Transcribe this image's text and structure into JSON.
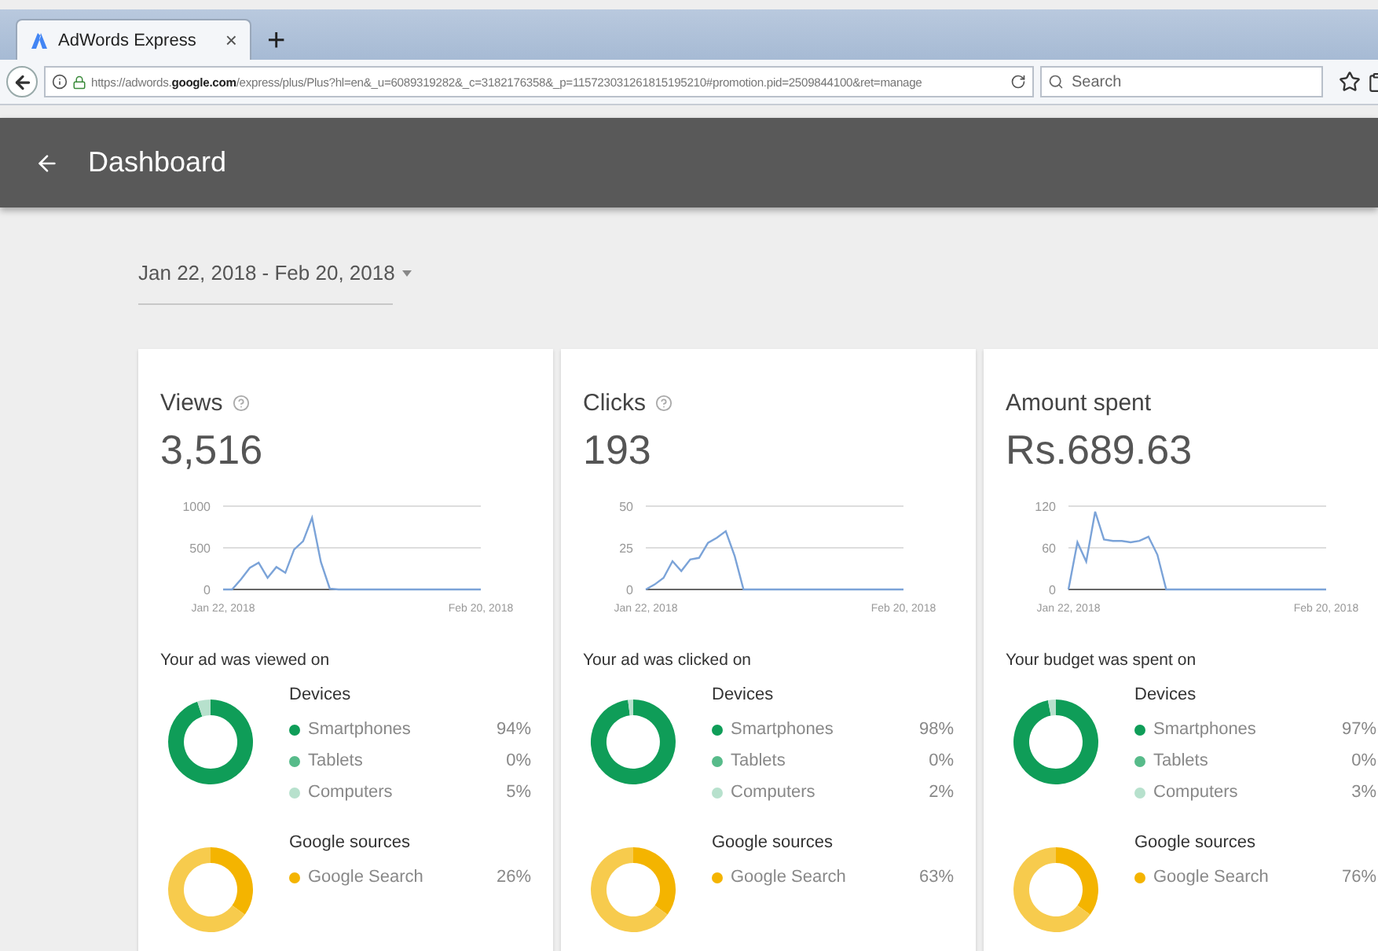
{
  "browser": {
    "tab_title": "AdWords Express",
    "tab_close": "×",
    "new_tab": "+",
    "url": "https://adwords.**google.com**/express/plus/Plus?hl=en&_u=6089319282&_c=3182176358&_p=115723031261815195210#promotion.pid=2509844100&ret=manage",
    "search_placeholder": "Search"
  },
  "header": {
    "title": "Dashboard"
  },
  "date_range": "Jan 22, 2018 - Feb 20, 2018",
  "cards": [
    {
      "title": "Views",
      "help": true,
      "value": "3,516",
      "chart_data": {
        "type": "line",
        "categories": [
          "Jan 22, 2018",
          null,
          null,
          null,
          null,
          null,
          null,
          null,
          null,
          null,
          null,
          null,
          null,
          null,
          null,
          null,
          null,
          null,
          null,
          null,
          null,
          null,
          null,
          null,
          null,
          null,
          null,
          null,
          null,
          "Feb 20, 2018"
        ],
        "values": [
          0,
          0,
          120,
          260,
          320,
          140,
          270,
          200,
          480,
          580,
          860,
          330,
          10,
          0,
          0,
          0,
          0,
          0,
          0,
          0,
          0,
          0,
          0,
          0,
          0,
          0,
          0,
          0,
          0,
          0
        ],
        "ylim": [
          0,
          1000
        ],
        "yticks": [
          0,
          500,
          1000
        ]
      },
      "breakdown_title": "Your ad was viewed on",
      "groups": [
        {
          "title": "Devices",
          "chart_data": {
            "type": "donut",
            "categories": [
              "Smartphones",
              "Tablets",
              "Computers"
            ],
            "values": [
              94,
              0,
              5
            ]
          },
          "items": [
            {
              "value": "94%",
              "color": "#0f9d58"
            },
            {
              "value": "0%",
              "color": "#57bb8a"
            },
            {
              "value": "5%",
              "color": "#b7e1cd"
            }
          ]
        },
        {
          "title": "Google sources",
          "items": [
            {
              "label": "Google Search",
              "value": "26%",
              "color": "#f4b400"
            }
          ]
        }
      ]
    },
    {
      "title": "Clicks",
      "help": true,
      "value": "193",
      "chart_data": {
        "type": "line",
        "categories": [
          "Jan 22, 2018",
          null,
          null,
          null,
          null,
          null,
          null,
          null,
          null,
          null,
          null,
          null,
          null,
          null,
          null,
          null,
          null,
          null,
          null,
          null,
          null,
          null,
          null,
          null,
          null,
          null,
          null,
          null,
          null,
          "Feb 20, 2018"
        ],
        "values": [
          0,
          3,
          7,
          17,
          11,
          18,
          19,
          28,
          31,
          35,
          20,
          0,
          0,
          0,
          0,
          0,
          0,
          0,
          0,
          0,
          0,
          0,
          0,
          0,
          0,
          0,
          0,
          0,
          0,
          0
        ],
        "ylim": [
          0,
          50
        ],
        "yticks": [
          0,
          25,
          50
        ]
      },
      "breakdown_title": "Your ad was clicked on",
      "groups": [
        {
          "title": "Devices",
          "chart_data": {
            "type": "donut",
            "categories": [
              "Smartphones",
              "Tablets",
              "Computers"
            ],
            "values": [
              98,
              0,
              2
            ]
          },
          "items": [
            {
              "value": "98%",
              "color": "#0f9d58"
            },
            {
              "value": "0%",
              "color": "#57bb8a"
            },
            {
              "value": "2%",
              "color": "#b7e1cd"
            }
          ]
        },
        {
          "title": "Google sources",
          "items": [
            {
              "label": "Google Search",
              "value": "63%",
              "color": "#f4b400"
            }
          ]
        }
      ]
    },
    {
      "title": "Amount spent",
      "help": false,
      "value": "Rs.689.63",
      "chart_data": {
        "type": "line",
        "categories": [
          "Jan 22, 2018",
          null,
          null,
          null,
          null,
          null,
          null,
          null,
          null,
          null,
          null,
          null,
          null,
          null,
          null,
          null,
          null,
          null,
          null,
          null,
          null,
          null,
          null,
          null,
          null,
          null,
          null,
          null,
          null,
          "Feb 20, 2018"
        ],
        "values": [
          0,
          68,
          40,
          112,
          72,
          70,
          70,
          68,
          70,
          76,
          50,
          0,
          0,
          0,
          0,
          0,
          0,
          0,
          0,
          0,
          0,
          0,
          0,
          0,
          0,
          0,
          0,
          0,
          0,
          0
        ],
        "ylim": [
          0,
          120
        ],
        "yticks": [
          0,
          60,
          120
        ]
      },
      "breakdown_title": "Your budget was spent on",
      "groups": [
        {
          "title": "Devices",
          "chart_data": {
            "type": "donut",
            "categories": [
              "Smartphones",
              "Tablets",
              "Computers"
            ],
            "values": [
              97,
              0,
              3
            ]
          },
          "items": [
            {
              "value": "97%",
              "color": "#0f9d58"
            },
            {
              "value": "0%",
              "color": "#57bb8a"
            },
            {
              "value": "3%",
              "color": "#b7e1cd"
            }
          ]
        },
        {
          "title": "Google sources",
          "items": [
            {
              "label": "Google Search",
              "value": "76%",
              "color": "#f4b400"
            }
          ]
        }
      ]
    }
  ]
}
